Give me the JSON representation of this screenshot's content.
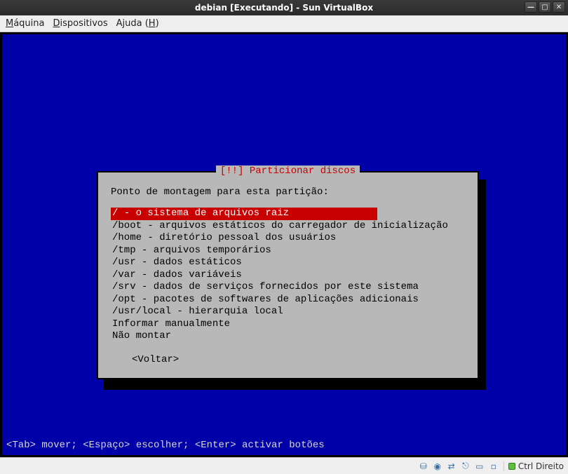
{
  "window": {
    "title": "debian [Executando] - Sun VirtualBox"
  },
  "menubar": {
    "machine": "Máquina",
    "devices": "Dispositivos",
    "help": "Ajuda (H)"
  },
  "dialog": {
    "title": "[!!] Particionar discos",
    "prompt": "Ponto de montagem para esta partição:",
    "options": [
      "/ - o sistema de arquivos raiz",
      "/boot - arquivos estáticos do carregador de inicialização",
      "/home - diretório pessoal dos usuários",
      "/tmp - arquivos temporários",
      "/usr - dados estáticos",
      "/var - dados variáveis",
      "/srv - dados de serviços fornecidos por este sistema",
      "/opt - pacotes de softwares de aplicações adicionais",
      "/usr/local - hierarquia local",
      "Informar manualmente",
      "Não montar"
    ],
    "selected_index": 0,
    "back_label": "<Voltar>"
  },
  "hint": "<Tab> mover; <Espaço> escolher; <Enter> activar botões",
  "statusbar": {
    "host_key": "Ctrl Direito"
  }
}
